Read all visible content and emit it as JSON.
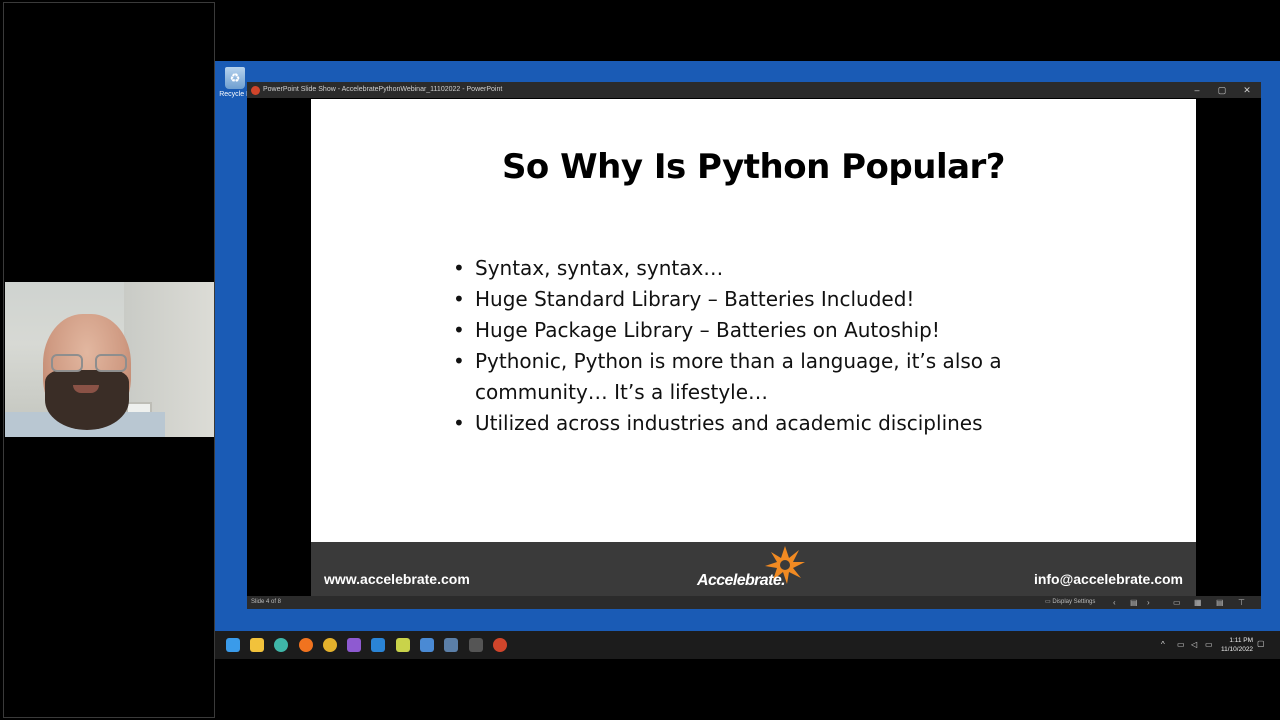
{
  "desktop": {
    "recycle_bin_label": "Recycle B"
  },
  "window": {
    "title": "PowerPoint Slide Show  -  AccelebratePythonWebinar_11102022  -  PowerPoint",
    "minimize": "–",
    "maximize": "▢",
    "close": "✕"
  },
  "slide": {
    "title": "So Why Is Python Popular?",
    "bullets": [
      "Syntax, syntax, syntax…",
      "Huge Standard Library – Batteries Included!",
      "Huge Package Library – Batteries on Autoship!",
      "Pythonic, Python is more than a language, it’s also a community… It’s a lifestyle…",
      "Utilized across industries and academic disciplines"
    ],
    "footer": {
      "url": "www.accelebrate.com",
      "logo_text": "Accelebrate.",
      "email": "info@accelebrate.com"
    }
  },
  "statusbar": {
    "slide_counter": "Slide 4 of 8",
    "display_settings": "Display Settings"
  },
  "taskbar": {
    "time": "1:11 PM",
    "date": "11/10/2022"
  },
  "colors": {
    "desktop": "#1a5bb5",
    "logo_accent": "#f18a22",
    "footer_band": "#3a3a3a"
  }
}
